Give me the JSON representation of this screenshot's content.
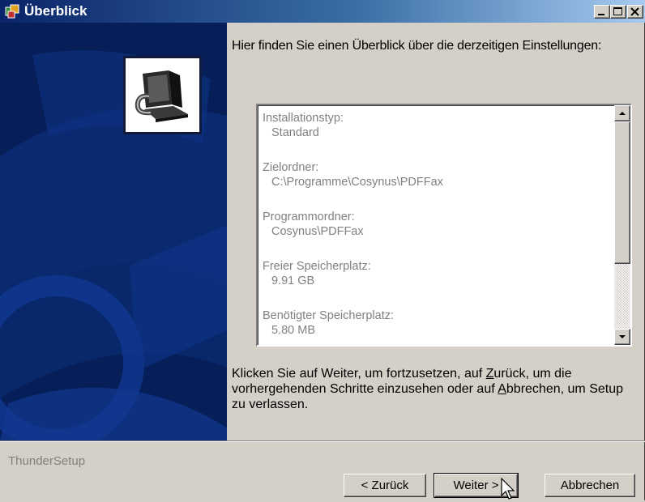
{
  "window": {
    "title": "Überblick",
    "controls": {
      "minimize": "minimize-icon",
      "maximize": "maximize-icon",
      "close": "close-icon"
    }
  },
  "main": {
    "intro": "Hier finden Sie einen Überblick über die derzeitigen Einstellungen:",
    "summary": [
      {
        "label": "Installationstyp:",
        "value": "Standard"
      },
      {
        "label": "Zielordner:",
        "value": "C:\\Programme\\Cosynus\\PDFFax"
      },
      {
        "label": "Programmordner:",
        "value": "Cosynus\\PDFFax"
      },
      {
        "label": "Freier Speicherplatz:",
        "value": "9.91 GB"
      },
      {
        "label": "Benötigter Speicherplatz:",
        "value": "5.80 MB"
      }
    ],
    "instructions": {
      "part1": "Klicken Sie auf Weiter, um fortzusetzen, auf ",
      "back_key": "Z",
      "part2": "urück, um die vorhergehenden Schritte einzusehen oder auf ",
      "cancel_key": "A",
      "part3": "bbrechen, um Setup zu verlassen."
    }
  },
  "footer": {
    "brand": "ThunderSetup",
    "buttons": {
      "back": "< Zurück",
      "next": "Weiter >",
      "cancel": "Abbrechen"
    }
  },
  "colors": {
    "title_bar": "#0a246a",
    "side_panel": "#06225c",
    "dialog_face": "#d4d0c8",
    "disabled_text": "#808080"
  }
}
